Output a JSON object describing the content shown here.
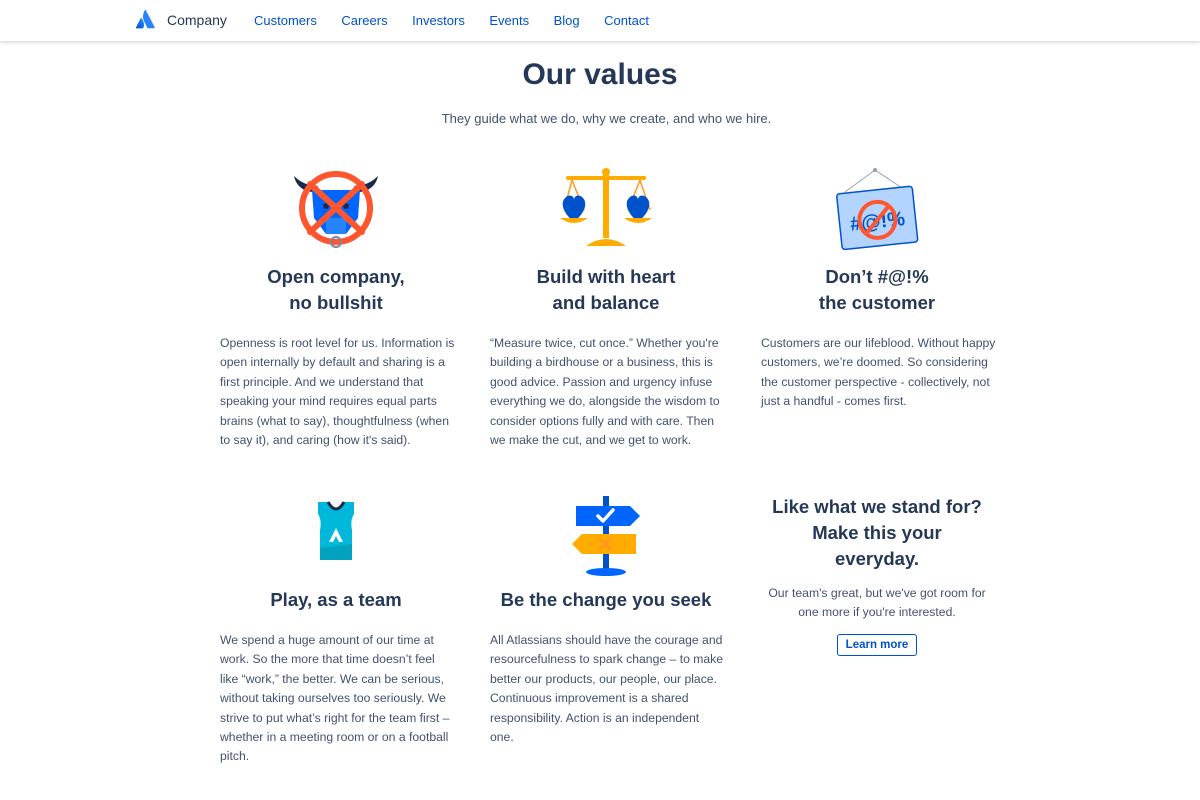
{
  "nav": {
    "brand": "Company",
    "links": [
      "Customers",
      "Careers",
      "Investors",
      "Events",
      "Blog",
      "Contact"
    ]
  },
  "header": {
    "title": "Our values",
    "subtitle": "They guide what we do, why we create, and who we hire."
  },
  "values": [
    {
      "icon": "bull-crossed-out-icon",
      "title_line1": "Open company,",
      "title_line2": "no bullshit",
      "text": "Openness is root level for us. Information is open internally by default and sharing is a first principle. And we understand that speaking your mind requires equal parts brains (what to say), thoughtfulness (when to say it), and caring (how it's said)."
    },
    {
      "icon": "balance-scale-hearts-icon",
      "title_line1": "Build with heart",
      "title_line2": "and balance",
      "text": "“Measure twice, cut once.” Whether you're building a birdhouse or a business, this is good advice. Passion and urgency infuse everything we do, alongside the wisdom to consider options fully and with care. Then we make the cut, and we get to work."
    },
    {
      "icon": "no-swearing-sign-icon",
      "title_line1": "Don’t #@!%",
      "title_line2": "the customer",
      "text": "Customers are our lifeblood. Without happy customers, we’re doomed. So considering the customer perspective - collectively, not just a handful - comes first."
    },
    {
      "icon": "team-jersey-icon",
      "title": "Play, as a team",
      "text": "We spend a huge amount of our time at work. So the more that time doesn’t feel like “work,” the better. We can be serious, without taking ourselves too seriously. We strive to put what’s right for the team first – whether in a meeting room or on a football pitch."
    },
    {
      "icon": "signpost-icon",
      "title": "Be the change you seek",
      "text": "All Atlassians should have the courage and resourcefulness to spark change – to make better our products, our people, our place. Continuous improvement is a shared responsibility. Action is an independent one."
    }
  ],
  "cta": {
    "title_line1": "Like what we stand for?",
    "title_line2": "Make this your",
    "title_line3": "everyday.",
    "text": "Our team's great, but we've got room for one more if you're interested.",
    "button": "Learn more"
  },
  "colors": {
    "brand_blue": "#0052cc",
    "heading": "#253858",
    "body_text": "#42526e",
    "accent_red": "#ff5630",
    "accent_yellow": "#ffab00"
  }
}
